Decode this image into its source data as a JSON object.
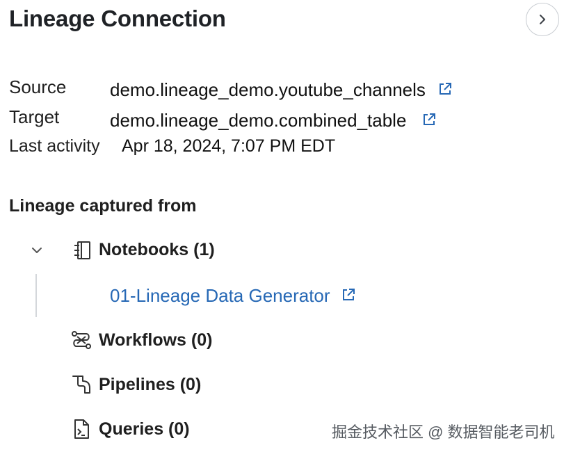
{
  "header": {
    "title": "Lineage Connection"
  },
  "details": {
    "source_label": "Source",
    "source_value": "demo.lineage_demo.youtube_channels",
    "target_label": "Target",
    "target_value": "demo.lineage_demo.combined_table",
    "activity_label": "Last activity",
    "activity_value": "Apr 18, 2024, 7:07 PM EDT"
  },
  "lineage": {
    "title": "Lineage captured from",
    "notebooks": {
      "label": "Notebooks (1)",
      "icon": "notebook-icon",
      "items": [
        "01-Lineage Data Generator"
      ]
    },
    "workflows": {
      "label": "Workflows (0)",
      "icon": "workflow-icon"
    },
    "pipelines": {
      "label": "Pipelines (0)",
      "icon": "pipeline-icon"
    },
    "queries": {
      "label": "Queries (0)",
      "icon": "query-icon"
    }
  },
  "watermark": "掘金技术社区 @ 数据智能老司机",
  "colors": {
    "link": "#2668b5",
    "text": "#1f1f1f",
    "border": "#c9cdd2"
  }
}
